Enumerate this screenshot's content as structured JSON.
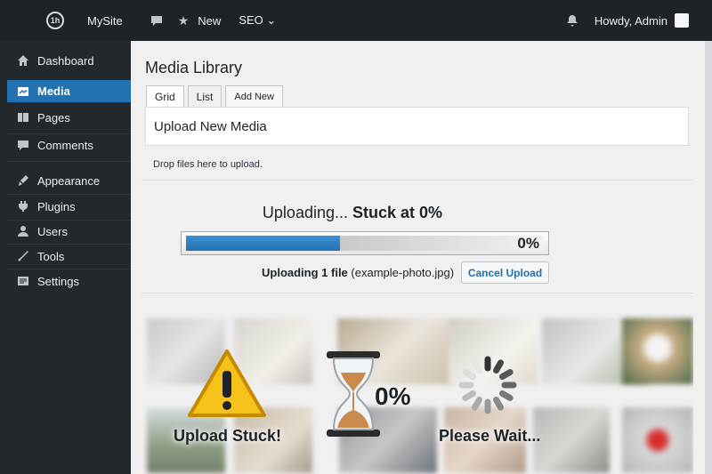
{
  "adminbar": {
    "site_name": "MySite",
    "new_label": "New",
    "seo_label": "SEO ⌄",
    "greeting": "Howdy, Admin"
  },
  "sidebar": {
    "items": [
      {
        "label": "Dashboard",
        "icon": "dashboard-icon"
      },
      {
        "label": "Media",
        "icon": "media-icon",
        "active": true
      },
      {
        "label": "Pages",
        "icon": "pages-icon"
      },
      {
        "label": "Comments",
        "icon": "comments-icon"
      },
      {
        "label": "Appearance",
        "icon": "appearance-icon"
      },
      {
        "label": "Plugins",
        "icon": "plugins-icon"
      },
      {
        "label": "Users",
        "icon": "users-icon"
      },
      {
        "label": "Tools",
        "icon": "tools-icon"
      },
      {
        "label": "Settings",
        "icon": "settings-icon"
      }
    ]
  },
  "main": {
    "title": "Media Library",
    "tabs": [
      "Grid",
      "List",
      "Add New"
    ],
    "upload_title": "Upload New Media",
    "drop_text": "Drop files here to upload.",
    "status_prefix": "Uploading...",
    "status_strong": "Stuck at 0%",
    "progress_percent_label": "0%",
    "progress_value": 0.43,
    "file_count": "Uploading 1 file",
    "file_name": "(example-photo.jpg)",
    "cancel_label": "Cancel Upload"
  },
  "overlay": {
    "stuck_label": "Upload Stuck!",
    "hourglass_pct": "0%",
    "wait_label": "Please Wait..."
  },
  "colors": {
    "accent": "#2271b1",
    "adminbar_bg": "#1d2327",
    "sidebar_bg": "#23282d",
    "warning": "#f0b400"
  }
}
